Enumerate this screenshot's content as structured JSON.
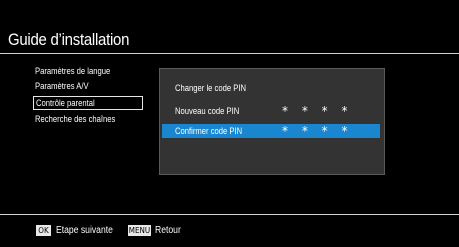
{
  "header": {
    "title": "Guide d’installation"
  },
  "menu": {
    "items": [
      {
        "label": "Paramètres de langue"
      },
      {
        "label": "Paramètres A/V"
      },
      {
        "label": "Contrôle parental"
      },
      {
        "label": "Recherche des chaînes"
      }
    ],
    "selected_index": 2
  },
  "panel": {
    "heading": "Changer le code PIN",
    "rows": [
      {
        "label": "Nouveau code PIN",
        "value": "* * * *"
      },
      {
        "label": "Confirmer code PIN",
        "value": "* * * *"
      }
    ]
  },
  "footer": {
    "ok_key": "OK",
    "ok_label": "Etape suivante",
    "menu_key": "MENU",
    "menu_label": "Retour"
  },
  "colors": {
    "background": "#000000",
    "panel": "#333333",
    "highlight": "#1a86cf",
    "key": "#e8e8e8"
  }
}
